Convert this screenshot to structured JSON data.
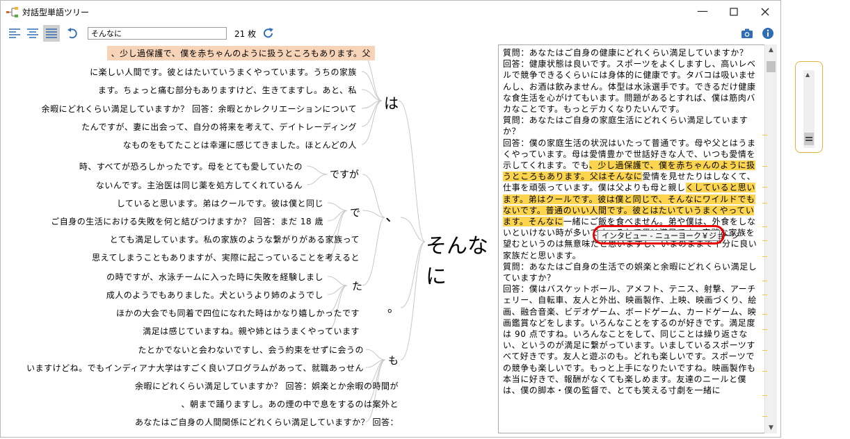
{
  "window": {
    "title": "対話型単語ツリー"
  },
  "toolbar": {
    "search_value": "そんなに",
    "count": "21 枚"
  },
  "tree": {
    "root": "そんなに",
    "branches": [
      "は",
      "、",
      "ですが",
      "で",
      "た",
      "。",
      "も"
    ],
    "left_lines": [
      "、少し過保護で、僕を赤ちゃんのように扱うところもあります。父",
      "に楽しい人間です。彼とはたいていうまくやっています。うちの家族",
      "ます。ちょっと痛む部分もありますけど、生きてますし。あと、私",
      "余暇にどれくらい満足していますか？ 回答：余暇とかレクリエーションについて",
      "たんですが、妻に出会って、自分の将来を考えて、デイトレーディング",
      "なものをもてたことは幸運に感じてきました。ほとんどの人",
      "時、すべてが恐ろしかったです。母をとても愛していたの",
      "ないんです。主治医は同じ薬を処方してくれているん",
      "していると思います。弟はクールです。彼は僕と同じ",
      "ご自身の生活における失敗を何と結びつけますか？ 回答：まだ 18 歳",
      "とても満足しています。私の家族のような繋がりがある家族って",
      "思えてしまうこともありますが、実際に起こっていることを考えると",
      "の時ですが、水泳チームに入った時に失敗を経験しまし",
      "成人のようでもありました。犬というより姉のようでし",
      "ほかの大会でも同着で四位になれた時はかなり嬉しかったです",
      "満足は感じていますね。親や姉とはうまくやっています",
      "たとかでないと会わないですし、会う約束をせずに会うの",
      "いますけどね。でもインディアナ大学はすごく良いプログラムがあって、就職あっせん",
      "余暇にどれくらい満足していますか？ 回答：娯楽とか余暇の時間が",
      "、朝まで踊りますし。あの煙の中で息をするのは案外と",
      "あなたはご自身の人間関係にどれくらい満足していますか？ 回答："
    ]
  },
  "document": {
    "paragraphs": [
      {
        "segments": [
          {
            "t": "質問：あなたはご自身の健康にどれくらい満足していますか？",
            "h": false
          }
        ]
      },
      {
        "segments": [
          {
            "t": "回答：健康状態は良いです。スポーツをよくしますし、高いレベルで競争できるくらいには身体的に健康です。タバコは吸いませんし、お酒は飲みません。体型は水泳選手です。できるだけ健康な食生活を心がけてもいます。問題があるとすれば、僕は筋肉バカなことです。もっとデカくなりたいんです。",
            "h": false
          }
        ]
      },
      {
        "segments": [
          {
            "t": "質問：あなたはご自身の家庭生活にどれくらい満足していますか？",
            "h": false
          }
        ]
      },
      {
        "segments": [
          {
            "t": "回答：僕の家庭生活の状況はいたって普通です。母や父とはうまくやっています。母は愛情豊かで世話好きな人で、いつも愛情を示してくれます。でも",
            "h": false
          },
          {
            "t": "、少し過保護で、僕を赤ちゃんのように扱うところもあります。父はそんなに",
            "h": true
          },
          {
            "t": "愛情を見せたりはしなくて、仕事を頑張っています。僕は父よりも母と親し",
            "h": false
          },
          {
            "t": "くしていると思います。弟はクールです。彼は僕と同じで、そんなにワイルドでもないです。普通のいい人間です。彼とはたいていうまくやっています。そんなに",
            "h": true
          },
          {
            "t": "一緒にご飯を食べません。弟や僕は、外食をしないといけない時が多いです。それで僕は満足です。完璧な家族を望むというのは無意味だと思いますし、いまのままで十分に良い家族だと思います。",
            "h": false
          }
        ]
      },
      {
        "segments": [
          {
            "t": "質問：あなたはご自身の生活での娯楽と余暇にどれくらい満足していますか？",
            "h": false
          }
        ]
      },
      {
        "segments": [
          {
            "t": "回答：僕はバスケットボール、アメフト、テニス、射撃、アーチェリー、自転車、友人と外出、映画製作、上映、映画づくり、絵画、融合音楽、ビデオゲーム、ボードゲーム、カードゲーム、映画鑑賞などをします。いろんなことをするのが好きです。満足度は 90 点ですね。いろんなことをして、同じことは繰り返さない、というのが満足に繋がっています。いましているスポーツすべて好きです。友人と遊ぶのも。どれも楽しいです。スポーツでの競争も楽しいです。もっと上手になりたいですね。映画製作も本当に好きで、報酬がなくても楽しめます。友達のニールと僕は、僕の脚本・僕の監督で、とても笑える寸劇を一緒に",
            "h": false
          }
        ]
      }
    ]
  },
  "tooltip": {
    "text": "インタビュー - ニューヨーク￥ジョージ"
  }
}
